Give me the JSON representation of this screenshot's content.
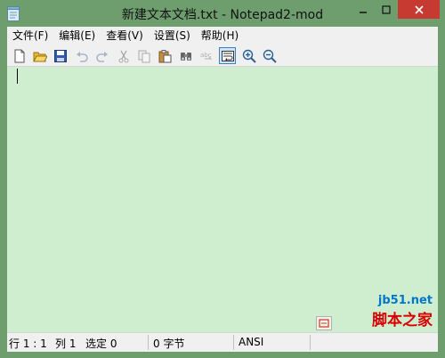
{
  "window": {
    "title": "新建文本文档.txt - Notepad2-mod",
    "close_color": "#c73a32",
    "editor_background": "#cfedcf"
  },
  "menu": [
    {
      "label": "文件(F)"
    },
    {
      "label": "编辑(E)"
    },
    {
      "label": "查看(V)"
    },
    {
      "label": "设置(S)"
    },
    {
      "label": "帮助(H)"
    }
  ],
  "toolbar": {
    "buttons": [
      {
        "icon": "new-file-icon",
        "enabled": true
      },
      {
        "icon": "open-folder-icon",
        "enabled": true
      },
      {
        "icon": "save-icon",
        "enabled": true
      },
      {
        "icon": "undo-icon",
        "enabled": false
      },
      {
        "icon": "redo-icon",
        "enabled": false
      },
      {
        "icon": "cut-icon",
        "enabled": false
      },
      {
        "icon": "copy-icon",
        "enabled": false
      },
      {
        "icon": "paste-icon",
        "enabled": true
      },
      {
        "icon": "find-icon",
        "enabled": true
      },
      {
        "icon": "replace-icon",
        "enabled": false
      },
      {
        "icon": "word-wrap-icon",
        "enabled": true,
        "pressed": true
      },
      {
        "icon": "zoom-in-icon",
        "enabled": true
      },
      {
        "icon": "zoom-out-icon",
        "enabled": true
      }
    ]
  },
  "status": {
    "position": "行 1 : 1",
    "column": "列 1",
    "selection": "选定 0",
    "size": "0 字节",
    "encoding": "ANSI"
  },
  "watermark": {
    "site": "jb51.net",
    "name": "脚本之家"
  }
}
